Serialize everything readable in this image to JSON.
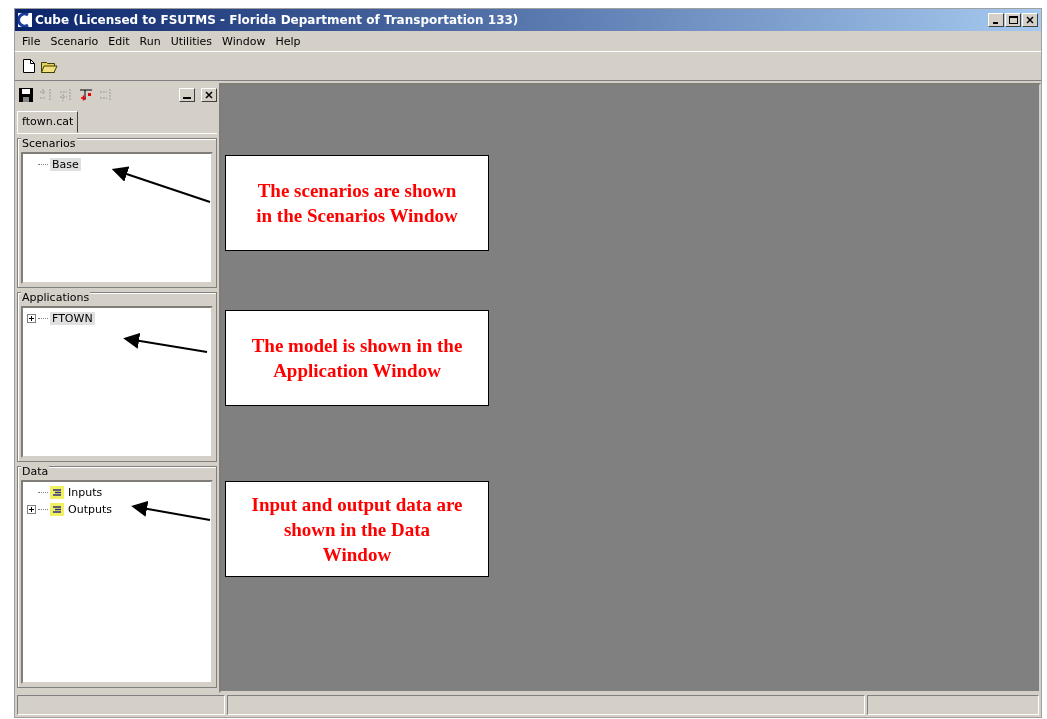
{
  "window": {
    "title": "Cube (Licensed to FSUTMS - Florida Department of Transportation 133)"
  },
  "menu": [
    "File",
    "Scenario",
    "Edit",
    "Run",
    "Utilities",
    "Window",
    "Help"
  ],
  "catalog_tab": {
    "label": "ftown.cat",
    "selected": true
  },
  "panels": [
    {
      "title": "Scenarios",
      "items": [
        {
          "label": "Base",
          "kind": "leaf",
          "selected": true,
          "icon": false
        }
      ]
    },
    {
      "title": "Applications",
      "items": [
        {
          "label": "FTOWN",
          "kind": "folder",
          "selected": true,
          "icon": false
        }
      ]
    },
    {
      "title": "Data",
      "items": [
        {
          "label": "Inputs",
          "kind": "leaf",
          "selected": false,
          "icon": true
        },
        {
          "label": "Outputs",
          "kind": "folder",
          "selected": false,
          "icon": true
        }
      ]
    }
  ],
  "callouts": [
    {
      "text": "The scenarios are shown in the Scenarios Window"
    },
    {
      "text": "The model is shown in the Application Window"
    },
    {
      "text": "Input and output data are shown in the Data Window"
    }
  ]
}
